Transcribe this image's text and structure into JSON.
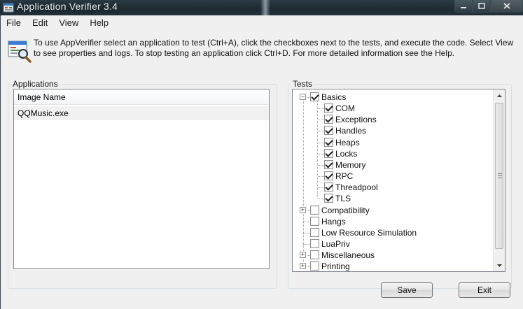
{
  "window": {
    "title": "Application Verifier 3.4",
    "accent": "#1d2a31"
  },
  "menu": {
    "items": [
      "File",
      "Edit",
      "View",
      "Help"
    ]
  },
  "info": {
    "text": "To use AppVerifier select an application to test (Ctrl+A), click the checkboxes next to the tests, and execute the code. Select View to see properties and logs. To stop testing an application click Ctrl+D. For more detailed information see the Help."
  },
  "applications": {
    "title": "Applications",
    "column_header": "Image Name",
    "rows": [
      "QQMusic.exe"
    ]
  },
  "tests": {
    "title": "Tests",
    "items": [
      {
        "label": "Basics",
        "checked": true,
        "level": 0,
        "expander": "-"
      },
      {
        "label": "COM",
        "checked": true,
        "level": 1,
        "expander": ""
      },
      {
        "label": "Exceptions",
        "checked": true,
        "level": 1,
        "expander": ""
      },
      {
        "label": "Handles",
        "checked": true,
        "level": 1,
        "expander": ""
      },
      {
        "label": "Heaps",
        "checked": true,
        "level": 1,
        "expander": ""
      },
      {
        "label": "Locks",
        "checked": true,
        "level": 1,
        "expander": ""
      },
      {
        "label": "Memory",
        "checked": true,
        "level": 1,
        "expander": ""
      },
      {
        "label": "RPC",
        "checked": true,
        "level": 1,
        "expander": ""
      },
      {
        "label": "Threadpool",
        "checked": true,
        "level": 1,
        "expander": ""
      },
      {
        "label": "TLS",
        "checked": true,
        "level": 1,
        "expander": ""
      },
      {
        "label": "Compatibility",
        "checked": false,
        "level": 0,
        "expander": "+"
      },
      {
        "label": "Hangs",
        "checked": false,
        "level": 0,
        "expander": ""
      },
      {
        "label": "Low Resource Simulation",
        "checked": false,
        "level": 0,
        "expander": ""
      },
      {
        "label": "LuaPriv",
        "checked": false,
        "level": 0,
        "expander": ""
      },
      {
        "label": "Miscellaneous",
        "checked": false,
        "level": 0,
        "expander": "+"
      },
      {
        "label": "Printing",
        "checked": false,
        "level": 0,
        "expander": "+"
      }
    ]
  },
  "buttons": {
    "save": "Save",
    "exit": "Exit"
  },
  "icons": {
    "app": "appverifier-icon",
    "info": "magnifier-info-icon"
  }
}
